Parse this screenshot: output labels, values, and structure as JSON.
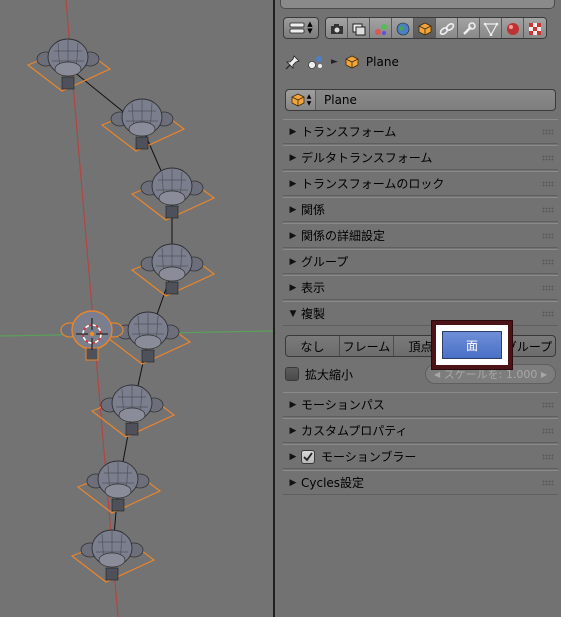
{
  "properties": {
    "breadcrumb": {
      "object_name": "Plane"
    },
    "datablock": {
      "name": "Plane"
    },
    "panels": [
      {
        "label": "トランスフォーム",
        "expanded": false
      },
      {
        "label": "デルタトランスフォーム",
        "expanded": false
      },
      {
        "label": "トランスフォームのロック",
        "expanded": false
      },
      {
        "label": "関係",
        "expanded": false
      },
      {
        "label": "関係の詳細設定",
        "expanded": false
      },
      {
        "label": "グループ",
        "expanded": false
      },
      {
        "label": "表示",
        "expanded": false
      },
      {
        "label": "複製",
        "expanded": true
      },
      {
        "label": "モーションパス",
        "expanded": false
      },
      {
        "label": "カスタムプロパティ",
        "expanded": false
      },
      {
        "label": "モーションブラー",
        "expanded": false
      },
      {
        "label": "Cycles設定",
        "expanded": false
      }
    ],
    "duplication": {
      "options": [
        "なし",
        "フレーム",
        "頂点",
        "面",
        "グループ"
      ],
      "selected": "面",
      "scale_checkbox_label": "拡大縮小",
      "scale_field": "スケールを: 1.000"
    }
  },
  "colors": {
    "accent_blue": "#4a70c8",
    "highlight_border": "#4d1418",
    "active_object_outline": "#e87d2a"
  }
}
